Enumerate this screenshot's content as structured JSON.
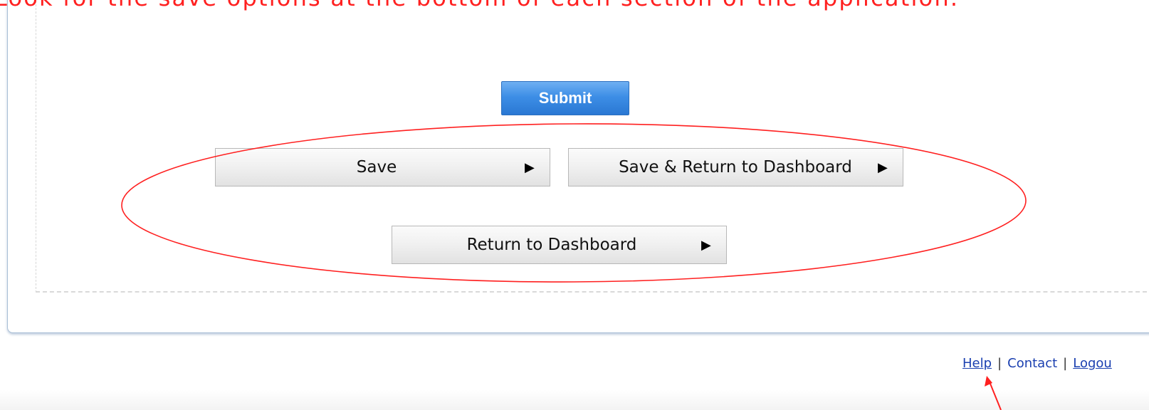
{
  "annotations": {
    "top_text": "Look for the save options at the bottom of each section of the application.",
    "color": "#ff2020"
  },
  "form": {
    "submit_label": "Submit",
    "save_label": "Save",
    "save_return_label": "Save & Return to Dashboard",
    "return_label": "Return to Dashboard",
    "arrow_icon": "play-arrow-icon",
    "submit_color": "#3d8ee6"
  },
  "footer": {
    "help": "Help",
    "contact": "Contact",
    "logout": "Logou",
    "separator": "|",
    "link_color": "#1a3fb0"
  }
}
